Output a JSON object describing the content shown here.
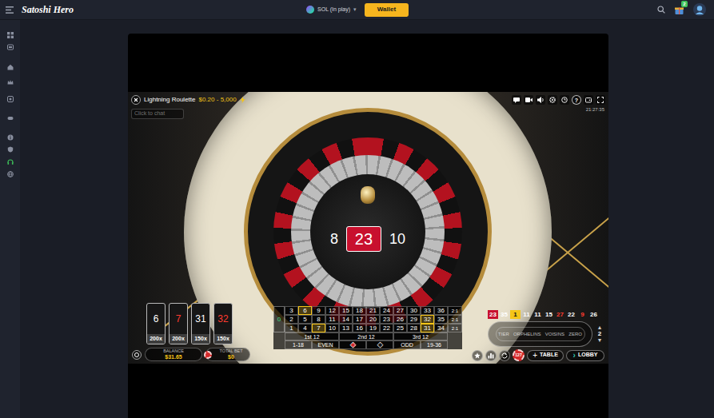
{
  "topbar": {
    "logo": "Satoshi Hero",
    "currency": {
      "label": "SOL (In play)",
      "caret": "▾"
    },
    "wallet": "Wallet",
    "badge": "2"
  },
  "game": {
    "title": "Lightning Roulette",
    "limits": "$0.20 - 5,000",
    "chat_placeholder": "Click to chat",
    "help": "?",
    "time": "21:27:35",
    "result": {
      "previous": "8",
      "number": "23",
      "next": "10",
      "color": "#c8102e"
    },
    "lightning": [
      {
        "number": "6",
        "multiplier": "200x",
        "color": "#ffffff"
      },
      {
        "number": "7",
        "multiplier": "200x",
        "color": "#ff3b30"
      },
      {
        "number": "31",
        "multiplier": "150x",
        "color": "#ffffff"
      },
      {
        "number": "32",
        "multiplier": "150x",
        "color": "#ff3b30"
      }
    ],
    "balance": {
      "label": "BALANCE",
      "value": "$31.65"
    },
    "total_bet": {
      "label": "TOTAL BET",
      "value": "$0"
    },
    "board": {
      "zero": "0",
      "rows": [
        [
          {
            "n": "3",
            "lit": false
          },
          {
            "n": "6",
            "lit": true
          },
          {
            "n": "9",
            "lit": false
          },
          {
            "n": "12",
            "lit": false
          },
          {
            "n": "15",
            "lit": false
          },
          {
            "n": "18",
            "lit": false
          },
          {
            "n": "21",
            "lit": false
          },
          {
            "n": "24",
            "lit": false
          },
          {
            "n": "27",
            "lit": false
          },
          {
            "n": "30",
            "lit": false
          },
          {
            "n": "33",
            "lit": false
          },
          {
            "n": "36",
            "lit": false
          }
        ],
        [
          {
            "n": "2",
            "lit": false
          },
          {
            "n": "5",
            "lit": false
          },
          {
            "n": "8",
            "lit": false
          },
          {
            "n": "11",
            "lit": false
          },
          {
            "n": "14",
            "lit": false
          },
          {
            "n": "17",
            "lit": false
          },
          {
            "n": "20",
            "lit": false
          },
          {
            "n": "23",
            "lit": false
          },
          {
            "n": "26",
            "lit": false
          },
          {
            "n": "29",
            "lit": false
          },
          {
            "n": "32",
            "lit": true
          },
          {
            "n": "35",
            "lit": false
          }
        ],
        [
          {
            "n": "1",
            "lit": false
          },
          {
            "n": "4",
            "lit": false
          },
          {
            "n": "7",
            "lit": true
          },
          {
            "n": "10",
            "lit": false
          },
          {
            "n": "13",
            "lit": false
          },
          {
            "n": "16",
            "lit": false
          },
          {
            "n": "19",
            "lit": false
          },
          {
            "n": "22",
            "lit": false
          },
          {
            "n": "25",
            "lit": false
          },
          {
            "n": "28",
            "lit": false
          },
          {
            "n": "31",
            "lit": true
          },
          {
            "n": "34",
            "lit": false
          }
        ]
      ],
      "columns": [
        "2:1",
        "2:1",
        "2:1"
      ],
      "dozens": [
        "1st 12",
        "2nd 12",
        "3rd 12"
      ],
      "outside": [
        {
          "label": "1-18",
          "kind": "text",
          "color": "#ffffff"
        },
        {
          "label": "EVEN",
          "kind": "text",
          "color": "#ffffff"
        },
        {
          "label": "◆",
          "kind": "diamond",
          "color": "#d0282a"
        },
        {
          "label": "◆",
          "kind": "diamond",
          "color": "#111111"
        },
        {
          "label": "ODD",
          "kind": "text",
          "color": "#ffffff"
        },
        {
          "label": "19-36",
          "kind": "text",
          "color": "#ffffff"
        }
      ]
    },
    "history": [
      {
        "n": "23",
        "color": "#ff3b30",
        "selected": true,
        "lightning": false
      },
      {
        "n": "35",
        "color": "#ffffff",
        "selected": false,
        "lightning": false
      },
      {
        "n": "1",
        "color": "#ff3b30",
        "selected": false,
        "lightning": true
      },
      {
        "n": "11",
        "color": "#ffffff",
        "selected": false,
        "lightning": false
      },
      {
        "n": "11",
        "color": "#ffffff",
        "selected": false,
        "lightning": false
      },
      {
        "n": "15",
        "color": "#ffffff",
        "selected": false,
        "lightning": false
      },
      {
        "n": "27",
        "color": "#ff3b30",
        "selected": false,
        "lightning": false
      },
      {
        "n": "22",
        "color": "#ffffff",
        "selected": false,
        "lightning": false
      },
      {
        "n": "9",
        "color": "#ff3b30",
        "selected": false,
        "lightning": false
      },
      {
        "n": "26",
        "color": "#ffffff",
        "selected": false,
        "lightning": false
      }
    ],
    "racetrack": {
      "labels": [
        "TIER",
        "ORPHELINS",
        "VOISINS",
        "ZERO"
      ],
      "up": "▴",
      "neighbours": "2",
      "down": "▾"
    },
    "chip": "127",
    "table_button": {
      "icon": "+",
      "label": "TABLE"
    },
    "lobby_button": {
      "icon": "›",
      "label": "LOBBY"
    }
  }
}
